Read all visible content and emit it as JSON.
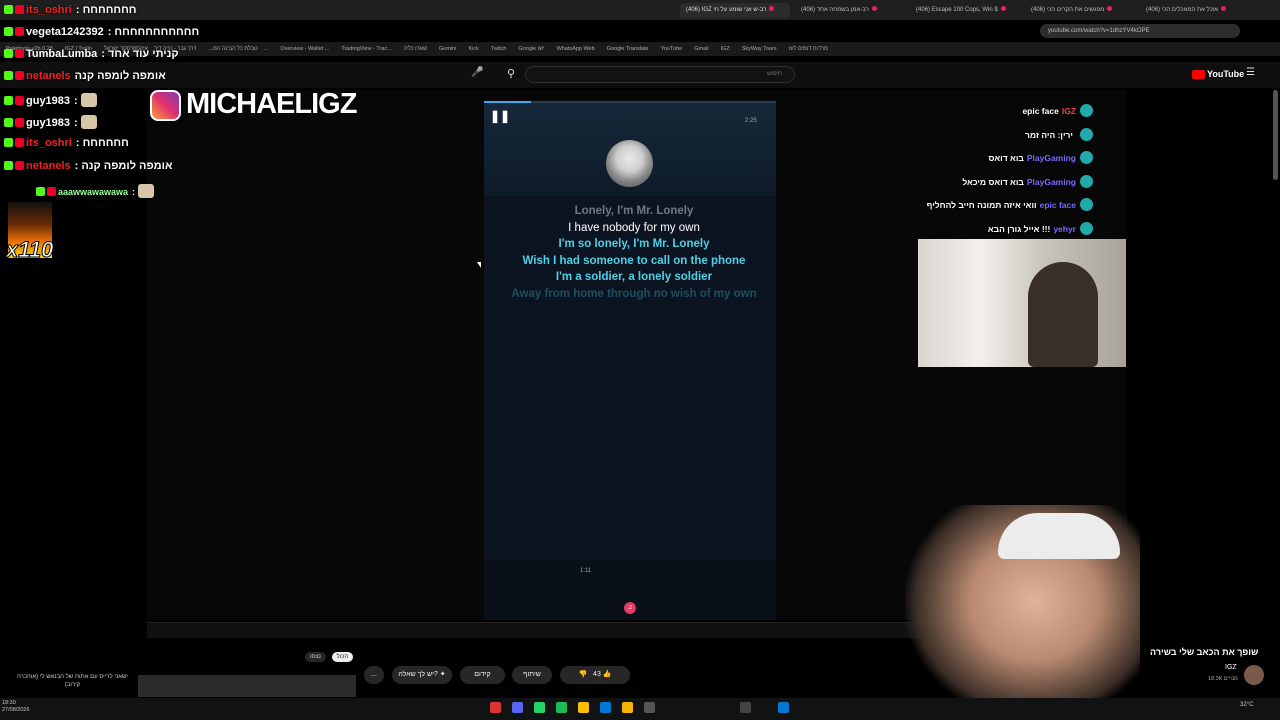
{
  "browser": {
    "tabs": [
      {
        "label": "(406) IGZ רב-ש אני שומע על חי",
        "active": true,
        "recording": true
      },
      {
        "label": "(406) רב-אמן בשמחה אחד",
        "active": false,
        "recording": true
      },
      {
        "label": "(406) Escape 100 Cops, Win $",
        "active": false,
        "recording": true
      },
      {
        "label": "(406) מפגשים את הקרים הכי",
        "active": false,
        "recording": true
      },
      {
        "label": "(406) אוכל את המאכלים הכי",
        "active": false,
        "recording": true
      }
    ],
    "url": "youtube.com/watch?v=1dhzYV4kOPE",
    "bookmarks": [
      "Palettools v2b.0.28",
      "IGZ | Trello",
      "טבלת כל הבינה המ...",
      "דרך גבר - הייה דיר",
      "איקספרססר ישראל...",
      "Overview - Wallet ...",
      "TradingView - Trac...",
      "שארו כליכ",
      "Gemini",
      "Kick",
      "Twitch",
      "Google ישו",
      "WhatsApp Web",
      "Google Translate",
      "YouTube",
      "Gmail",
      "IGZ",
      "SkyWay Tours",
      "מרדות דומים לעז"
    ]
  },
  "youtube": {
    "search_placeholder": "חיפוש",
    "logo_text": "YouTube"
  },
  "player": {
    "progress": 0.16,
    "duration": "2:25",
    "lyrics": {
      "past": "Lonely, I'm Mr. Lonely",
      "current": "I have nobody for my own",
      "next": [
        "I'm so lonely, I'm Mr. Lonely",
        "Wish I had someone to call on the phone",
        "I'm a soldier, a lonely soldier"
      ],
      "fading": "Away from home through no wish of my own"
    },
    "scrubber_time": "1:11"
  },
  "overlay": {
    "instagram_handle": "MICHAELIGZ",
    "fire_count": "x110",
    "chat_left": [
      {
        "user": "its_oshri",
        "text": ": חחחחחחח",
        "user_color": "red"
      },
      {
        "user": "vegeta1242392",
        "text": ": חחחחחחחחחחח",
        "user_color": "white"
      },
      {
        "user": "TumbaLumba",
        "text": ": קניתי עוד אחד",
        "user_color": "white"
      },
      {
        "user": "netanels",
        "text": "אומפה לומפה קנה",
        "user_color": "red"
      },
      {
        "user": "guy1983",
        "text": ":",
        "user_color": "white",
        "emote": true
      },
      {
        "user": "guy1983",
        "text": ":",
        "user_color": "white",
        "emote": true
      },
      {
        "user": "its_oshri",
        "text": ": חחחחחח",
        "user_color": "red"
      },
      {
        "user": "netanels",
        "text": ": אומפה לומפה קנה",
        "user_color": "red"
      },
      {
        "user": "aaawwawawawa",
        "text": ":",
        "user_color": "green",
        "emote": true
      }
    ],
    "chat_right": [
      {
        "user": "IGZ",
        "text": "epic face",
        "red": true
      },
      {
        "user": "",
        "text": "ירין: היה זמר"
      },
      {
        "user": "PlayGaming",
        "text": "בוא דואס"
      },
      {
        "user": "PlayGaming",
        "text": "בוא דואס מיכאל"
      },
      {
        "user": "epic face",
        "text": "וואי איזה תמונה חייב להחליף"
      },
      {
        "user": "yehyr",
        "text": "אייל גורן הבא !!!"
      }
    ]
  },
  "video_meta": {
    "title": "שופך את הכאב שלי בשירה",
    "channel": "IGZ",
    "subs": "18.3K מנויים",
    "likes": "43",
    "actions": {
      "share": "שיתוף",
      "promote": "קידום",
      "ask": "יש לך שאלה?",
      "more": "..."
    },
    "tags": [
      "הכול",
      "נצפו"
    ],
    "description_snippet": "ישאני לרייס עם אתות של הבנאש לי (אוהכרה קירוב)"
  },
  "taskbar": {
    "time": "18:30",
    "date": "27/08/2026",
    "search": "חיפוש",
    "lang": "ENG",
    "temp": "32°C"
  },
  "colors": {
    "accent": "#3fa9f5",
    "lyric_next": "#4fd0e6",
    "brand_red": "#ff0000"
  }
}
